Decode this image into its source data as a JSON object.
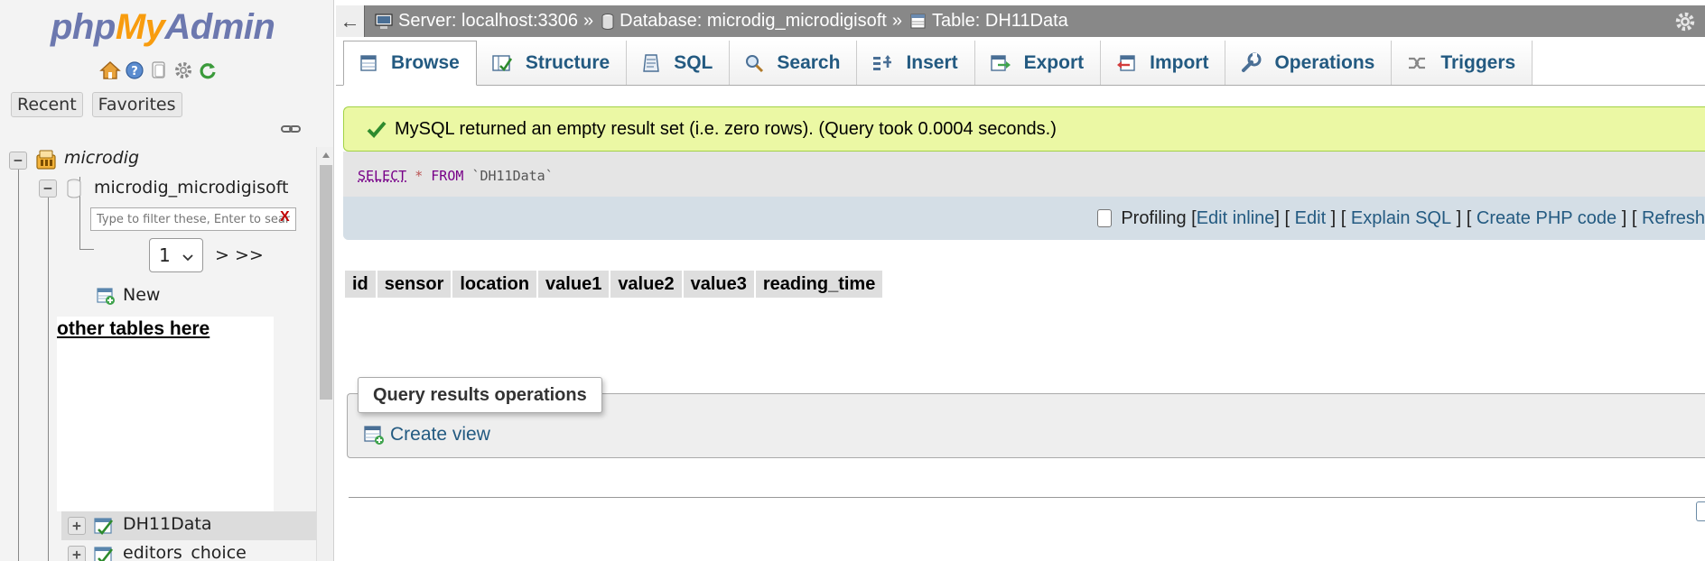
{
  "nav": {
    "logo": {
      "php": "php",
      "my": "My",
      "admin": "Admin"
    },
    "icons": [
      "home-icon",
      "help-icon",
      "docs-icon",
      "settings-icon",
      "reload-icon"
    ],
    "recent_label": "Recent",
    "favorites_label": "Favorites",
    "tree": {
      "server": "microdig",
      "database": "microdig_microdigisoft",
      "filter_placeholder": "Type to filter these, Enter to search all",
      "filter_clear": "X",
      "page_select": "1",
      "page_next": "> >>",
      "new_label": "New",
      "other_tables_note": "other tables here",
      "tables": [
        "DH11Data",
        "editors_choice"
      ]
    }
  },
  "topbar": {
    "back": "←",
    "server": "Server: localhost:3306",
    "database": "Database: microdig_microdigisoft",
    "table": "Table: DH11Data",
    "sep": "»"
  },
  "tabs": [
    {
      "label": "Browse",
      "icon": "browse-icon"
    },
    {
      "label": "Structure",
      "icon": "structure-icon"
    },
    {
      "label": "SQL",
      "icon": "sql-icon"
    },
    {
      "label": "Search",
      "icon": "search-icon"
    },
    {
      "label": "Insert",
      "icon": "insert-icon"
    },
    {
      "label": "Export",
      "icon": "export-icon"
    },
    {
      "label": "Import",
      "icon": "import-icon"
    },
    {
      "label": "Operations",
      "icon": "operations-icon"
    },
    {
      "label": "Triggers",
      "icon": "triggers-icon"
    }
  ],
  "message": "MySQL returned an empty result set (i.e. zero rows). (Query took 0.0004 seconds.)",
  "sql": {
    "select": "SELECT",
    "star": "*",
    "from": "FROM",
    "table": "`DH11Data`"
  },
  "profiling": {
    "label": "Profiling",
    "edit_inline": "Edit inline",
    "edit": "Edit",
    "explain": "Explain SQL",
    "create_php": "Create PHP code",
    "refresh": "Refresh"
  },
  "columns": [
    "id",
    "sensor",
    "location",
    "value1",
    "value2",
    "value3",
    "reading_time"
  ],
  "query_ops": {
    "legend": "Query results operations",
    "create_view": "Create view"
  },
  "colors": {
    "accent": "#235a81",
    "success_bg": "#ebf8a4",
    "topbar": "#888888"
  }
}
